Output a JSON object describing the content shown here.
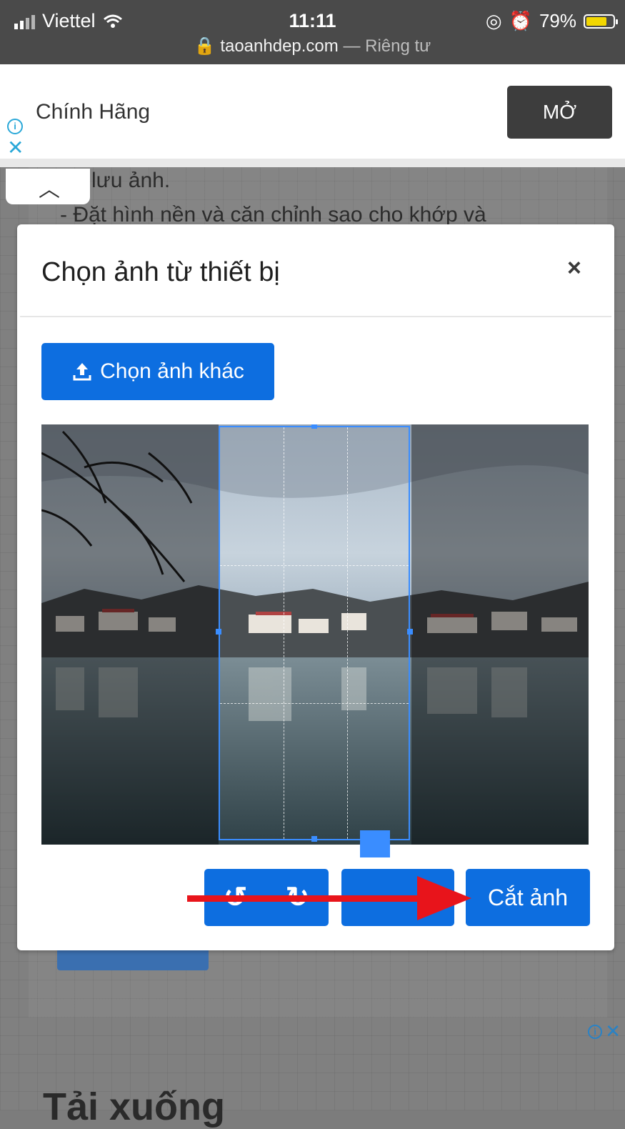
{
  "status_bar": {
    "carrier": "Viettel",
    "time": "11:11",
    "battery_text": "79%",
    "battery_level": 0.79,
    "url": "taoanhdep.com",
    "url_suffix": "— Riêng tư",
    "colors": {
      "battery_fill": "#f2d600"
    }
  },
  "ad_banner": {
    "text": "Chính Hãng",
    "button_label": "MỞ",
    "info_icon": "info-icon",
    "close_icon": "close-icon",
    "colors": {
      "accent": "#2aa8d8",
      "button": "#3d3d3d"
    }
  },
  "background_page": {
    "text_line1": "lưu ảnh.",
    "text_line2": "- Đặt hình nền và căn chỉnh sao cho khớp và",
    "footer_title": "Tải xuống",
    "collapse_icon": "chevron-up-icon"
  },
  "modal": {
    "title": "Chọn ảnh từ thiết bị",
    "close_label": "×",
    "choose_button_label": "Chọn ảnh khác",
    "choose_button_icon": "upload-icon",
    "rotate_left_icon": "rotate-left-icon",
    "rotate_right_icon": "rotate-right-icon",
    "flip_icon": "flip-icon",
    "crop_button_label": "Cắt ảnh",
    "colors": {
      "primary": "#0d6ee0",
      "crop_guide": "#3a8dff"
    }
  },
  "annotation": {
    "arrow_color": "#e8141b"
  }
}
